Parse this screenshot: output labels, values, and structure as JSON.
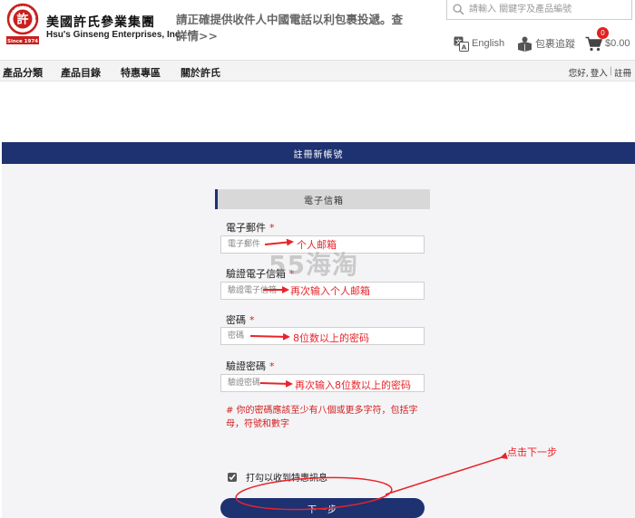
{
  "header": {
    "brand_cn": "美國許氏參業集團",
    "brand_en": "Hsu's Ginseng Enterprises, Inc.",
    "logo_text": "許",
    "logo_arc": "HSU'S · ROOT TO HEALTH",
    "logo_since": "Since 1974",
    "notice": "請正確提供收件人中國電話以利包裹投遞。查詳情>>",
    "search_placeholder": "請輸入 關鍵字及產品編號",
    "lang_label": "English",
    "track_label": "包裹追蹤",
    "cart_total": "$0.00",
    "cart_count": "0"
  },
  "nav": {
    "items": [
      "產品分類",
      "產品目錄",
      "特惠專區",
      "關於許氏"
    ],
    "user_greeting": "您好,",
    "login": "登入",
    "separator": "|",
    "register": "註冊"
  },
  "form": {
    "title": "註冊新帳號",
    "section": "電子信箱",
    "required_mark": "*",
    "fields": [
      {
        "label": "電子郵件",
        "placeholder": "電子郵件"
      },
      {
        "label": "驗證電子信箱",
        "placeholder": "驗證電子信箱"
      },
      {
        "label": "密碼",
        "placeholder": "密碼"
      },
      {
        "label": "驗證密碼",
        "placeholder": "驗證密碼"
      }
    ],
    "password_hint": "# 你的密碼應該至少有八個或更多字符，包括字母，符號和數字",
    "checkbox_label": "打勾以收到特惠訊息",
    "checkbox_checked": true,
    "next_label": "下一步"
  },
  "annotations": {
    "email": "个人邮箱",
    "verify_email": "再次输入个人邮箱",
    "password": "8位数以上的密码",
    "verify_password": "再次输入8位数以上的密码",
    "click_next": "点击下一步",
    "watermark": "55海淘"
  },
  "colors": {
    "brand_navy": "#1e3170",
    "logo_red": "#c8201e",
    "annotation_red": "#e8242a",
    "required_red": "#d02020"
  },
  "icons": [
    "search-icon",
    "translate-icon",
    "package-tracking-icon",
    "cart-icon"
  ]
}
